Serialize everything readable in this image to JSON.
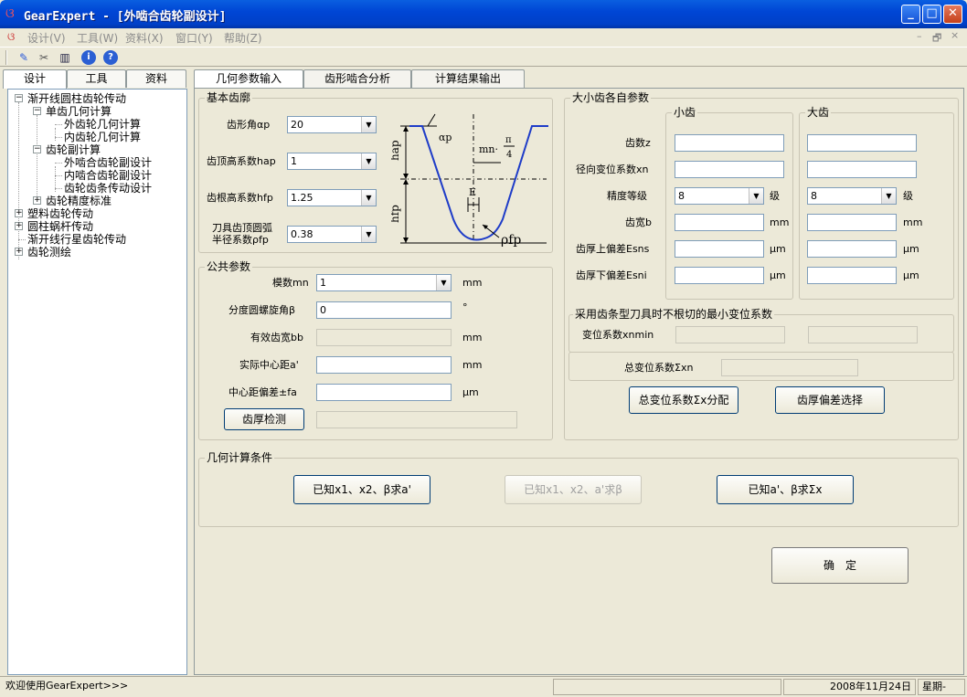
{
  "window": {
    "title": "GearExpert - [外啮合齿轮副设计]",
    "min": "_",
    "max": "□",
    "close": "✕"
  },
  "menu": [
    "设计(V)",
    "工具(W)",
    "资料(X)",
    "窗口(Y)",
    "帮助(Z)"
  ],
  "mdi_controls": [
    "–",
    "🗗",
    "×"
  ],
  "left_tabs": [
    "设计",
    "工具",
    "资料"
  ],
  "tree": [
    {
      "label": "渐开线圆柱齿轮传动",
      "box": "−"
    },
    {
      "label": "单齿几何计算",
      "box": "−"
    },
    {
      "label": "外齿轮几何计算"
    },
    {
      "label": "内齿轮几何计算"
    },
    {
      "label": "齿轮副计算",
      "box": "−"
    },
    {
      "label": "外啮合齿轮副设计"
    },
    {
      "label": "内啮合齿轮副设计"
    },
    {
      "label": "齿轮齿条传动设计"
    },
    {
      "label": "齿轮精度标准",
      "box": "+"
    },
    {
      "label": "塑料齿轮传动",
      "box": "+"
    },
    {
      "label": "圆柱蜗杆传动",
      "box": "+"
    },
    {
      "label": "渐开线行星齿轮传动"
    },
    {
      "label": "齿轮测绘",
      "box": "+"
    }
  ],
  "main_tabs": [
    "几何参数输入",
    "齿形啮合分析",
    "计算结果输出"
  ],
  "basic_profile": {
    "title": "基本齿廓",
    "fields": [
      {
        "label": "齿形角αp",
        "value": "20"
      },
      {
        "label": "齿顶高系数hap",
        "value": "1"
      },
      {
        "label": "齿根高系数hfp",
        "value": "1.25"
      },
      {
        "label_l1": "刀具齿顶圆弧",
        "label_l2": "半径系数ρfp",
        "value": "0.38"
      }
    ],
    "diagram": {
      "hap": "hap",
      "hfp": "hfp",
      "alpha": "αp",
      "mn": "mn·",
      "pi": "π",
      "four": "4",
      "e": "E",
      "rho": "ρfp"
    }
  },
  "common": {
    "title": "公共参数",
    "module_label": "模数mn",
    "module_value": "1",
    "module_unit": "mm",
    "helix_label": "分度圆螺旋角β",
    "helix_value": "0",
    "helix_unit": "°",
    "width_label": "有效齿宽bb",
    "width_value": "",
    "width_unit": "mm",
    "center_label": "实际中心距a'",
    "center_value": "",
    "center_unit": "mm",
    "dev_label": "中心距偏差±fa",
    "dev_value": "",
    "dev_unit": "μm",
    "check_btn": "齿厚检测",
    "check_value": ""
  },
  "gears": {
    "title": "大小齿各自参数",
    "small": "小齿",
    "large": "大齿",
    "rows": [
      {
        "label": "齿数z",
        "small": "",
        "large": "",
        "unit": ""
      },
      {
        "label": "径向变位系数xn",
        "small": "",
        "large": "",
        "unit": ""
      },
      {
        "label": "精度等级",
        "small": "8",
        "large": "8",
        "unit": "级"
      },
      {
        "label": "齿宽b",
        "small": "",
        "large": "",
        "unit": "mm"
      },
      {
        "label": "齿厚上偏差Esns",
        "small": "",
        "large": "",
        "unit": "μm"
      },
      {
        "label": "齿厚下偏差Esni",
        "small": "",
        "large": "",
        "unit": "μm"
      }
    ]
  },
  "min_shift": {
    "title": "采用齿条型刀具时不根切的最小变位系数",
    "label": "变位系数xnmin",
    "small": "",
    "large": ""
  },
  "total_shift": {
    "label": "总变位系数Σxn",
    "value": ""
  },
  "buttons": {
    "distribute": "总变位系数Σx分配",
    "thickness": "齿厚偏差选择"
  },
  "conditions": {
    "title": "几何计算条件",
    "b1": "已知x1、x2、β求a'",
    "b2": "已知x1、x2、a'求β",
    "b3": "已知a'、β求Σx"
  },
  "ok": "确　定",
  "status": {
    "welcome": "欢迎使用GearExpert>>>",
    "date": "2008年11月24日",
    "week": "星期-"
  }
}
